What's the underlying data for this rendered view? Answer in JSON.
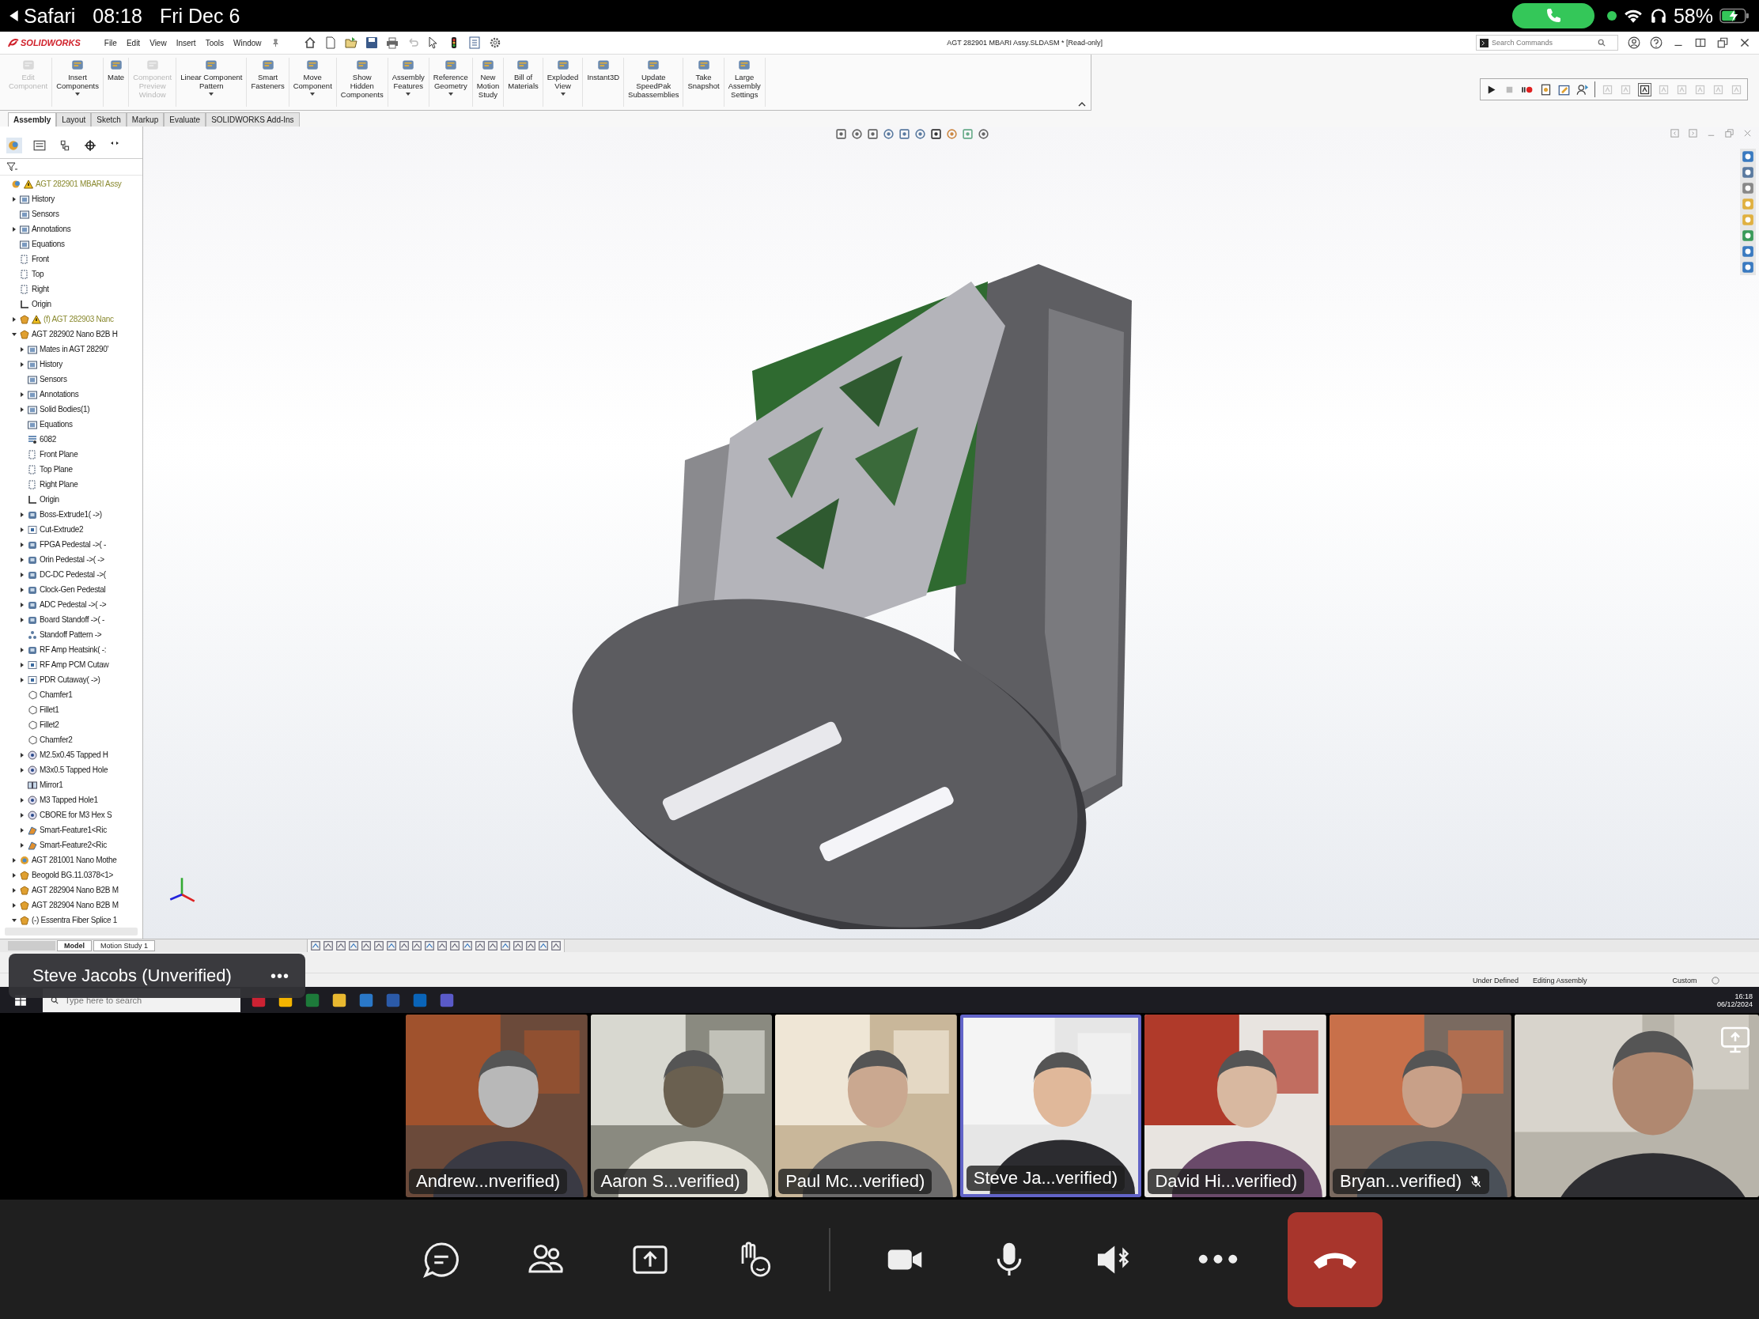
{
  "status_bar": {
    "back_label": "Safari",
    "time": "08:18",
    "date": "Fri Dec 6",
    "battery": "58%"
  },
  "solidworks": {
    "brand": "SOLIDWORKS",
    "menu": [
      "File",
      "Edit",
      "View",
      "Insert",
      "Tools",
      "Window"
    ],
    "document_title": "AGT 282901 MBARI Assy.SLDASM * [Read-only]",
    "search": {
      "placeholder": "Search Commands"
    },
    "commands": [
      {
        "label": "Edit\nComponent",
        "disabled": true,
        "dropdown": false
      },
      {
        "label": "Insert\nComponents",
        "disabled": false,
        "dropdown": true
      },
      {
        "label": "Mate",
        "disabled": false,
        "dropdown": false
      },
      {
        "label": "Component\nPreview\nWindow",
        "disabled": true,
        "dropdown": false
      },
      {
        "label": "Linear Component\nPattern",
        "disabled": false,
        "dropdown": true
      },
      {
        "label": "Smart\nFasteners",
        "disabled": false,
        "dropdown": false
      },
      {
        "label": "Move\nComponent",
        "disabled": false,
        "dropdown": true
      },
      {
        "label": "Show\nHidden\nComponents",
        "disabled": false,
        "dropdown": false
      },
      {
        "label": "Assembly\nFeatures",
        "disabled": false,
        "dropdown": true
      },
      {
        "label": "Reference\nGeometry",
        "disabled": false,
        "dropdown": true
      },
      {
        "label": "New\nMotion\nStudy",
        "disabled": false,
        "dropdown": false
      },
      {
        "label": "Bill of\nMaterials",
        "disabled": false,
        "dropdown": false
      },
      {
        "label": "Exploded\nView",
        "disabled": false,
        "dropdown": true
      },
      {
        "label": "Instant3D",
        "disabled": false,
        "dropdown": false
      },
      {
        "label": "Update\nSpeedPak\nSubassemblies",
        "disabled": false,
        "dropdown": false
      },
      {
        "label": "Take\nSnapshot",
        "disabled": false,
        "dropdown": false
      },
      {
        "label": "Large\nAssembly\nSettings",
        "disabled": false,
        "dropdown": false
      }
    ],
    "tabs": [
      {
        "label": "Assembly",
        "selected": true
      },
      {
        "label": "Layout",
        "selected": false
      },
      {
        "label": "Sketch",
        "selected": false
      },
      {
        "label": "Markup",
        "selected": false
      },
      {
        "label": "Evaluate",
        "selected": false
      },
      {
        "label": "SOLIDWORKS Add-Ins",
        "selected": false
      }
    ],
    "tree": [
      {
        "label": "AGT 282901 MBARI Assy",
        "kind": "assembly",
        "warning": true,
        "dimmed": true,
        "children": [
          {
            "label": "History",
            "kind": "folder",
            "expanded": false
          },
          {
            "label": "Sensors",
            "kind": "folder"
          },
          {
            "label": "Annotations",
            "kind": "folder",
            "expanded": false
          },
          {
            "label": "Equations",
            "kind": "folder"
          },
          {
            "label": "Front",
            "kind": "plane"
          },
          {
            "label": "Top",
            "kind": "plane"
          },
          {
            "label": "Right",
            "kind": "plane"
          },
          {
            "label": "Origin",
            "kind": "origin"
          },
          {
            "label": "(f) AGT 282903 Nanc",
            "kind": "part",
            "warning": true,
            "dimmed": true,
            "expanded": false
          },
          {
            "label": "AGT 282902 Nano B2B H",
            "kind": "part",
            "expanded": true,
            "children": [
              {
                "label": "Mates in AGT 28290'",
                "kind": "folder",
                "expanded": false
              },
              {
                "label": "History",
                "kind": "folder",
                "expanded": false
              },
              {
                "label": "Sensors",
                "kind": "folder"
              },
              {
                "label": "Annotations",
                "kind": "folder",
                "expanded": false
              },
              {
                "label": "Solid Bodies(1)",
                "kind": "folder",
                "expanded": false
              },
              {
                "label": "Equations",
                "kind": "folder"
              },
              {
                "label": "6082",
                "kind": "material"
              },
              {
                "label": "Front Plane",
                "kind": "plane"
              },
              {
                "label": "Top Plane",
                "kind": "plane"
              },
              {
                "label": "Right Plane",
                "kind": "plane"
              },
              {
                "label": "Origin",
                "kind": "origin"
              },
              {
                "label": "Boss-Extrude1( ->)",
                "kind": "feature",
                "expanded": false
              },
              {
                "label": "Cut-Extrude2",
                "kind": "cut",
                "expanded": false
              },
              {
                "label": "FPGA Pedestal ->( -",
                "kind": "feature",
                "expanded": false
              },
              {
                "label": "Orin Pedestal ->( ->",
                "kind": "feature",
                "expanded": false
              },
              {
                "label": "DC-DC Pedestal ->(",
                "kind": "feature",
                "expanded": false
              },
              {
                "label": "Clock-Gen Pedestal",
                "kind": "feature",
                "expanded": false
              },
              {
                "label": "ADC Pedestal ->( ->",
                "kind": "feature",
                "expanded": false
              },
              {
                "label": "Board Standoff ->( -",
                "kind": "feature",
                "expanded": false
              },
              {
                "label": "Standoff Pattern ->",
                "kind": "pattern"
              },
              {
                "label": "RF Amp Heatsink( -:",
                "kind": "feature",
                "expanded": false
              },
              {
                "label": "RF Amp PCM Cutaw",
                "kind": "cut",
                "expanded": false
              },
              {
                "label": "PDR Cutaway( ->)",
                "kind": "cut",
                "expanded": false
              },
              {
                "label": "Chamfer1",
                "kind": "fillet"
              },
              {
                "label": "Fillet1",
                "kind": "fillet"
              },
              {
                "label": "Fillet2",
                "kind": "fillet"
              },
              {
                "label": "Chamfer2",
                "kind": "fillet"
              },
              {
                "label": "M2.5x0.45 Tapped H",
                "kind": "hole",
                "expanded": false
              },
              {
                "label": "M3x0.5 Tapped Hole",
                "kind": "hole",
                "expanded": false
              },
              {
                "label": "Mirror1",
                "kind": "mirror"
              },
              {
                "label": "M3 Tapped Hole1",
                "kind": "hole",
                "expanded": false
              },
              {
                "label": "CBORE for M3 Hex S",
                "kind": "hole",
                "expanded": false
              },
              {
                "label": "Smart-Feature1<Ric",
                "kind": "smart",
                "expanded": false
              },
              {
                "label": "Smart-Feature2<Ric",
                "kind": "smart",
                "expanded": false
              }
            ]
          },
          {
            "label": "AGT 281001 Nano Mothe",
            "kind": "subassembly",
            "expanded": false
          },
          {
            "label": "Beogold BG.11.0378<1>",
            "kind": "part",
            "expanded": false
          },
          {
            "label": "AGT 282904 Nano B2B M",
            "kind": "part",
            "expanded": false
          },
          {
            "label": "AGT 282904 Nano B2B M",
            "kind": "part",
            "expanded": false
          },
          {
            "label": "(-) Essentra Fiber Splice 1",
            "kind": "part",
            "expanded": true
          }
        ]
      }
    ],
    "bottom_tabs": [
      {
        "label": "Model",
        "selected": true
      },
      {
        "label": "Motion Study 1",
        "selected": false
      }
    ],
    "status": [
      "Under Defined",
      "Editing Assembly"
    ],
    "units": "Custom",
    "taskbar": {
      "search_placeholder": "Type here to search",
      "time": "16:18",
      "date": "06/12/2024"
    }
  },
  "presenter_tag": {
    "name": "Steve Jacobs (Unverified)",
    "menu": "•••"
  },
  "participants": [
    {
      "name": "Andrew...nverified)",
      "active": false,
      "muted": false
    },
    {
      "name": "Aaron S...verified)",
      "active": false,
      "muted": false
    },
    {
      "name": "Paul Mc...verified)",
      "active": false,
      "muted": false
    },
    {
      "name": "Steve Ja...verified)",
      "active": true,
      "muted": false
    },
    {
      "name": "David Hi...verified)",
      "active": false,
      "muted": false
    },
    {
      "name": "Bryan...verified)",
      "active": false,
      "muted": true
    },
    {
      "kind": "picture",
      "active": false
    }
  ]
}
